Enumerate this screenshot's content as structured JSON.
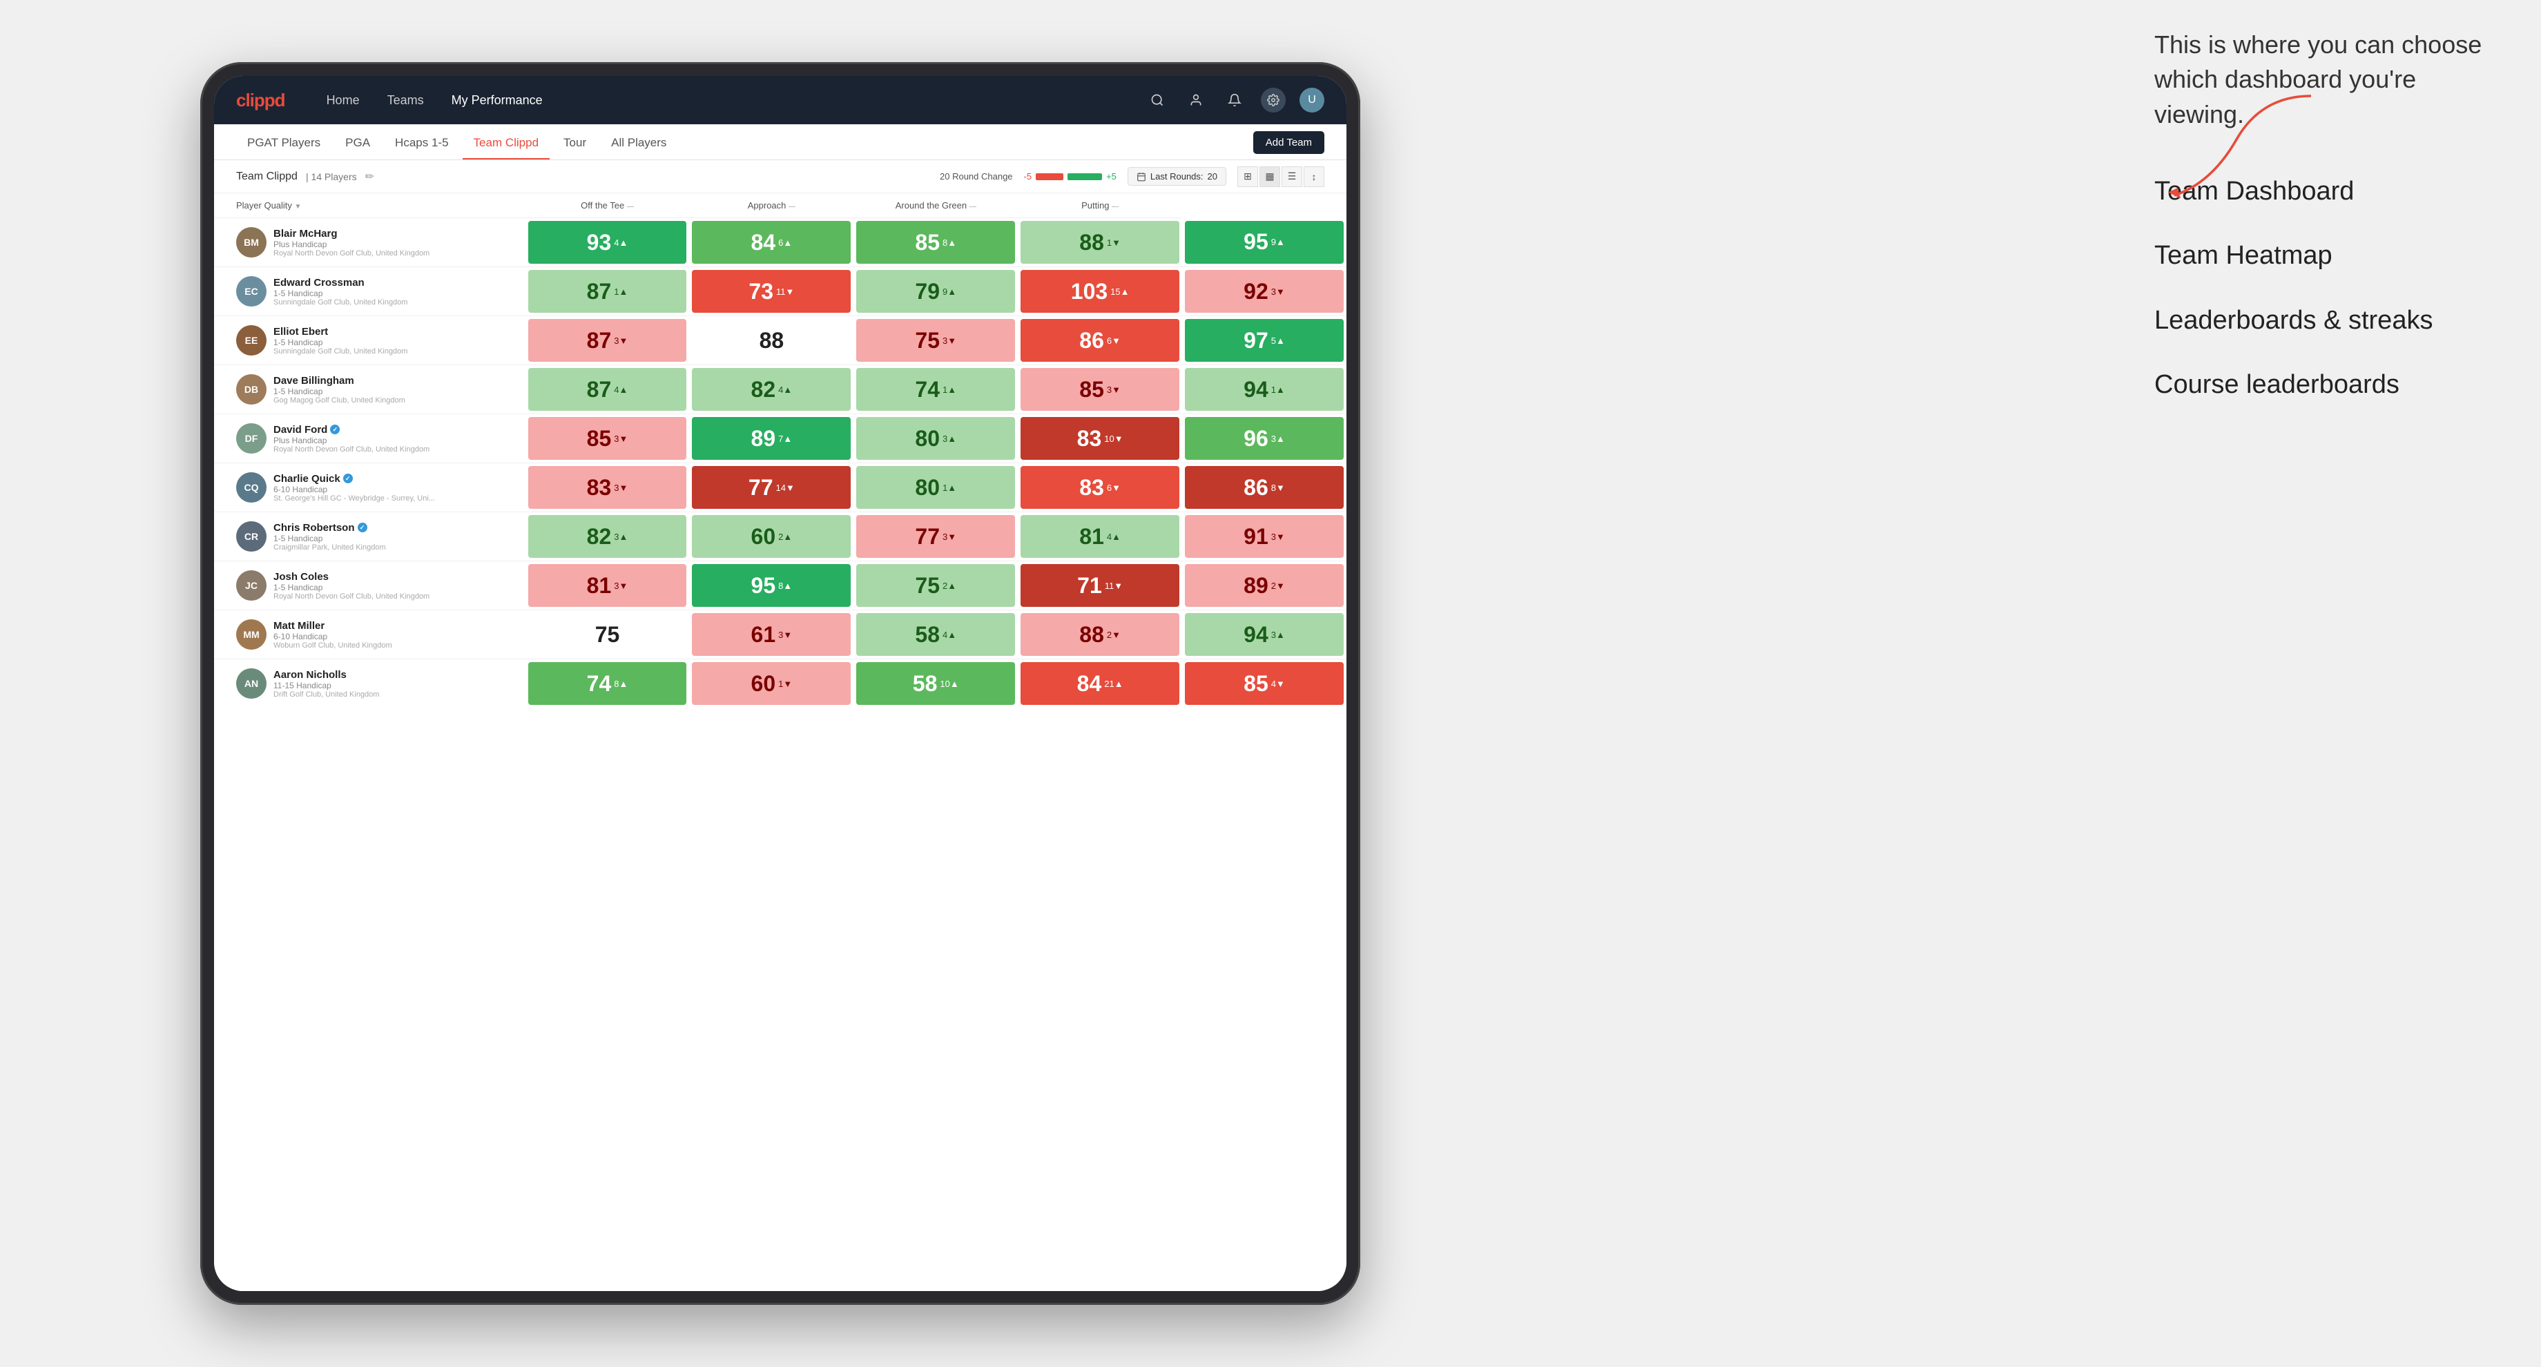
{
  "annotation": {
    "intro_text": "This is where you can choose which dashboard you're viewing.",
    "options": [
      "Team Dashboard",
      "Team Heatmap",
      "Leaderboards & streaks",
      "Course leaderboards"
    ]
  },
  "navbar": {
    "logo": "clippd",
    "nav_items": [
      "Home",
      "Teams",
      "My Performance"
    ],
    "active_nav": "My Performance",
    "icons": {
      "search": "🔍",
      "user": "👤",
      "bell": "🔔",
      "settings": "⚙",
      "avatar": "👤"
    }
  },
  "subnav": {
    "items": [
      "PGAT Players",
      "PGA",
      "Hcaps 1-5",
      "Team Clippd",
      "Tour",
      "All Players"
    ],
    "active": "Team Clippd",
    "add_team_label": "Add Team"
  },
  "team_info": {
    "name": "Team Clippd",
    "separator": "|",
    "count": "14 Players",
    "round_change_label": "20 Round Change",
    "neg_value": "-5",
    "pos_value": "+5",
    "last_rounds_label": "Last Rounds:",
    "last_rounds_value": "20"
  },
  "table": {
    "columns": {
      "player_quality": "Player Quality",
      "off_the_tee": "Off the Tee",
      "approach": "Approach",
      "around_the_green": "Around the Green",
      "putting": "Putting"
    },
    "players": [
      {
        "name": "Blair McHarg",
        "handicap": "Plus Handicap",
        "club": "Royal North Devon Golf Club, United Kingdom",
        "avatar_initials": "BM",
        "avatar_color": "#8B7355",
        "verified": false,
        "scores": {
          "player_quality": {
            "value": 93,
            "change": 4,
            "direction": "up",
            "color": "green-dark"
          },
          "off_the_tee": {
            "value": 84,
            "change": 6,
            "direction": "up",
            "color": "green-mid"
          },
          "approach": {
            "value": 85,
            "change": 8,
            "direction": "up",
            "color": "green-mid"
          },
          "around_the_green": {
            "value": 88,
            "change": 1,
            "direction": "down",
            "color": "green-light"
          },
          "putting": {
            "value": 95,
            "change": 9,
            "direction": "up",
            "color": "green-dark"
          }
        }
      },
      {
        "name": "Edward Crossman",
        "handicap": "1-5 Handicap",
        "club": "Sunningdale Golf Club, United Kingdom",
        "avatar_initials": "EC",
        "avatar_color": "#6B8E9F",
        "verified": false,
        "scores": {
          "player_quality": {
            "value": 87,
            "change": 1,
            "direction": "up",
            "color": "green-light"
          },
          "off_the_tee": {
            "value": 73,
            "change": 11,
            "direction": "down",
            "color": "red-mid"
          },
          "approach": {
            "value": 79,
            "change": 9,
            "direction": "up",
            "color": "green-light"
          },
          "around_the_green": {
            "value": 103,
            "change": 15,
            "direction": "up",
            "color": "red-mid"
          },
          "putting": {
            "value": 92,
            "change": 3,
            "direction": "down",
            "color": "red-light"
          }
        }
      },
      {
        "name": "Elliot Ebert",
        "handicap": "1-5 Handicap",
        "club": "Sunningdale Golf Club, United Kingdom",
        "avatar_initials": "EE",
        "avatar_color": "#8B5E3C",
        "verified": false,
        "scores": {
          "player_quality": {
            "value": 87,
            "change": 3,
            "direction": "down",
            "color": "red-light"
          },
          "off_the_tee": {
            "value": 88,
            "change": null,
            "direction": null,
            "color": "white-bg"
          },
          "approach": {
            "value": 75,
            "change": 3,
            "direction": "down",
            "color": "red-light"
          },
          "around_the_green": {
            "value": 86,
            "change": 6,
            "direction": "down",
            "color": "red-mid"
          },
          "putting": {
            "value": 97,
            "change": 5,
            "direction": "up",
            "color": "green-dark"
          }
        }
      },
      {
        "name": "Dave Billingham",
        "handicap": "1-5 Handicap",
        "club": "Gog Magog Golf Club, United Kingdom",
        "avatar_initials": "DB",
        "avatar_color": "#9E7B5A",
        "verified": false,
        "scores": {
          "player_quality": {
            "value": 87,
            "change": 4,
            "direction": "up",
            "color": "green-light"
          },
          "off_the_tee": {
            "value": 82,
            "change": 4,
            "direction": "up",
            "color": "green-light"
          },
          "approach": {
            "value": 74,
            "change": 1,
            "direction": "up",
            "color": "green-light"
          },
          "around_the_green": {
            "value": 85,
            "change": 3,
            "direction": "down",
            "color": "red-light"
          },
          "putting": {
            "value": 94,
            "change": 1,
            "direction": "up",
            "color": "green-light"
          }
        }
      },
      {
        "name": "David Ford",
        "handicap": "Plus Handicap",
        "club": "Royal North Devon Golf Club, United Kingdom",
        "avatar_initials": "DF",
        "avatar_color": "#7B9E8A",
        "verified": true,
        "scores": {
          "player_quality": {
            "value": 85,
            "change": 3,
            "direction": "down",
            "color": "red-light"
          },
          "off_the_tee": {
            "value": 89,
            "change": 7,
            "direction": "up",
            "color": "green-dark"
          },
          "approach": {
            "value": 80,
            "change": 3,
            "direction": "up",
            "color": "green-light"
          },
          "around_the_green": {
            "value": 83,
            "change": 10,
            "direction": "down",
            "color": "red-dark"
          },
          "putting": {
            "value": 96,
            "change": 3,
            "direction": "up",
            "color": "green-mid"
          }
        }
      },
      {
        "name": "Charlie Quick",
        "handicap": "6-10 Handicap",
        "club": "St. George's Hill GC - Weybridge - Surrey, Uni...",
        "avatar_initials": "CQ",
        "avatar_color": "#5A7A8B",
        "verified": true,
        "scores": {
          "player_quality": {
            "value": 83,
            "change": 3,
            "direction": "down",
            "color": "red-light"
          },
          "off_the_tee": {
            "value": 77,
            "change": 14,
            "direction": "down",
            "color": "red-dark"
          },
          "approach": {
            "value": 80,
            "change": 1,
            "direction": "up",
            "color": "green-light"
          },
          "around_the_green": {
            "value": 83,
            "change": 6,
            "direction": "down",
            "color": "red-mid"
          },
          "putting": {
            "value": 86,
            "change": 8,
            "direction": "down",
            "color": "red-dark"
          }
        }
      },
      {
        "name": "Chris Robertson",
        "handicap": "1-5 Handicap",
        "club": "Craigmillar Park, United Kingdom",
        "avatar_initials": "CR",
        "avatar_color": "#5C6B7A",
        "verified": true,
        "scores": {
          "player_quality": {
            "value": 82,
            "change": 3,
            "direction": "up",
            "color": "green-light"
          },
          "off_the_tee": {
            "value": 60,
            "change": 2,
            "direction": "up",
            "color": "green-light"
          },
          "approach": {
            "value": 77,
            "change": 3,
            "direction": "down",
            "color": "red-light"
          },
          "around_the_green": {
            "value": 81,
            "change": 4,
            "direction": "up",
            "color": "green-light"
          },
          "putting": {
            "value": 91,
            "change": 3,
            "direction": "down",
            "color": "red-light"
          }
        }
      },
      {
        "name": "Josh Coles",
        "handicap": "1-5 Handicap",
        "club": "Royal North Devon Golf Club, United Kingdom",
        "avatar_initials": "JC",
        "avatar_color": "#8B7B6A",
        "verified": false,
        "scores": {
          "player_quality": {
            "value": 81,
            "change": 3,
            "direction": "down",
            "color": "red-light"
          },
          "off_the_tee": {
            "value": 95,
            "change": 8,
            "direction": "up",
            "color": "green-dark"
          },
          "approach": {
            "value": 75,
            "change": 2,
            "direction": "up",
            "color": "green-light"
          },
          "around_the_green": {
            "value": 71,
            "change": 11,
            "direction": "down",
            "color": "red-dark"
          },
          "putting": {
            "value": 89,
            "change": 2,
            "direction": "down",
            "color": "red-light"
          }
        }
      },
      {
        "name": "Matt Miller",
        "handicap": "6-10 Handicap",
        "club": "Woburn Golf Club, United Kingdom",
        "avatar_initials": "MM",
        "avatar_color": "#A07850",
        "verified": false,
        "scores": {
          "player_quality": {
            "value": 75,
            "change": null,
            "direction": null,
            "color": "white-bg"
          },
          "off_the_tee": {
            "value": 61,
            "change": 3,
            "direction": "down",
            "color": "red-light"
          },
          "approach": {
            "value": 58,
            "change": 4,
            "direction": "up",
            "color": "green-light"
          },
          "around_the_green": {
            "value": 88,
            "change": 2,
            "direction": "down",
            "color": "red-light"
          },
          "putting": {
            "value": 94,
            "change": 3,
            "direction": "up",
            "color": "green-light"
          }
        }
      },
      {
        "name": "Aaron Nicholls",
        "handicap": "11-15 Handicap",
        "club": "Drift Golf Club, United Kingdom",
        "avatar_initials": "AN",
        "avatar_color": "#6A8B7A",
        "verified": false,
        "scores": {
          "player_quality": {
            "value": 74,
            "change": 8,
            "direction": "up",
            "color": "green-mid"
          },
          "off_the_tee": {
            "value": 60,
            "change": 1,
            "direction": "down",
            "color": "red-light"
          },
          "approach": {
            "value": 58,
            "change": 10,
            "direction": "up",
            "color": "green-mid"
          },
          "around_the_green": {
            "value": 84,
            "change": 21,
            "direction": "up",
            "color": "red-mid"
          },
          "putting": {
            "value": 85,
            "change": 4,
            "direction": "down",
            "color": "red-mid"
          }
        }
      }
    ]
  }
}
